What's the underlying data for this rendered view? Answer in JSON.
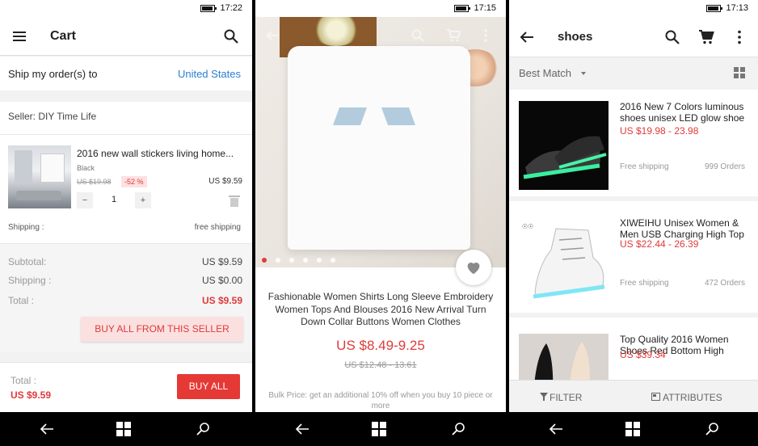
{
  "colors": {
    "accent": "#e53935",
    "link": "#2a7fd0"
  },
  "cart_screen": {
    "status_time": "17:22",
    "title": "Cart",
    "ship_to_label": "Ship my order(s) to",
    "ship_to_value": "United States",
    "seller": "Seller: DIY Time Life",
    "item": {
      "title": "2016 new wall stickers living home...",
      "variant": "Black",
      "old_price": "US $19.98",
      "discount": "-52 %",
      "price": "US $9.59",
      "quantity": "1",
      "minus": "−",
      "plus": "+"
    },
    "shipping_label": "Shipping :",
    "shipping_value": "free shipping",
    "summary": {
      "subtotal_label": "Subtotal:",
      "subtotal_value": "US $9.59",
      "shipping_label": "Shipping :",
      "shipping_value": "US $0.00",
      "total_label": "Total :",
      "total_value": "US $9.59"
    },
    "buy_seller_button": "BUY ALL FROM THIS SELLER",
    "footer_total_label": "Total :",
    "footer_total_value": "US $9.59",
    "buy_all_button": "BUY ALL"
  },
  "product_screen": {
    "status_time": "17:15",
    "title": "Fashionable Women Shirts Long Sleeve Embroidery Women Tops And Blouses 2016 New Arrival Turn Down Collar Buttons Women Clothes",
    "price": "US $8.49-9.25",
    "old_price": "US $12.48 - 13.61",
    "bulk_text": "Bulk Price: get an additional 10% off when you buy 10 piece or more",
    "image_dots": 6,
    "active_dot": 0
  },
  "search_screen": {
    "status_time": "17:13",
    "query": "shoes",
    "sort_label": "Best Match",
    "results": [
      {
        "title": "2016 New 7 Colors luminous shoes unisex LED glow shoe",
        "price": "US $19.98 - 23.98",
        "shipping": "Free shipping",
        "orders": "999 Orders"
      },
      {
        "title": "XIWEIHU Unisex Women & Men USB Charging High Top",
        "price": "US $22.44 - 26.39",
        "shipping": "Free shipping",
        "orders": "472 Orders"
      },
      {
        "title": "Top Quality 2016 Women Shoes Red Bottom High",
        "price": "US $39.34",
        "shipping": "",
        "orders": ""
      }
    ],
    "filter_label": "FILTER",
    "attributes_label": "ATTRIBUTES"
  }
}
